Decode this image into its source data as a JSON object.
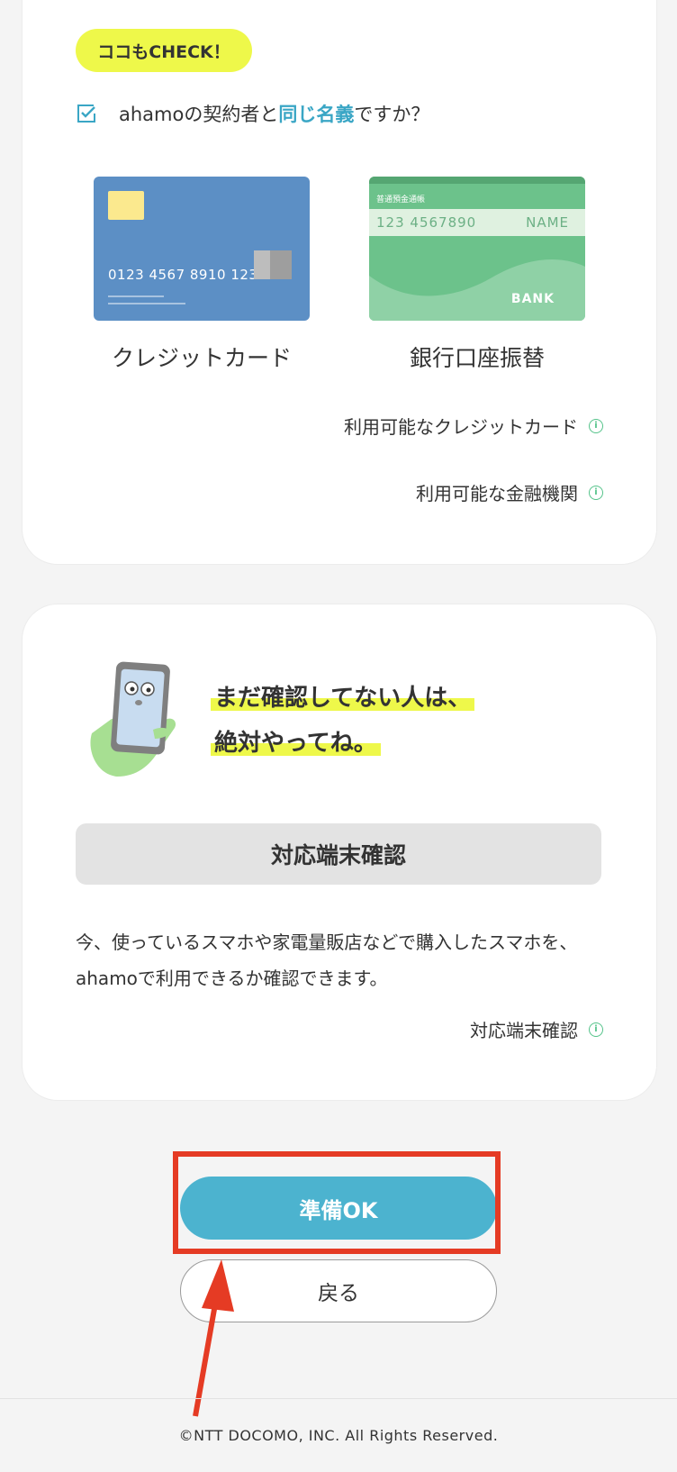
{
  "check_section": {
    "badge": "ココもCHECK！",
    "question_pre": "ahamoの契約者と",
    "question_highlight": "同じ名義",
    "question_post": "ですか？"
  },
  "credit_card": {
    "number": "0123 4567 8910 1234",
    "caption": "クレジットカード"
  },
  "bank_book": {
    "header": "普通預金通帳",
    "account": "123 4567890",
    "name": "NAME",
    "bank": "BANK",
    "caption": "銀行口座振替"
  },
  "links": {
    "credit_cards": "利用可能なクレジットカード",
    "banks": "利用可能な金融機関",
    "devices": "対応端末確認"
  },
  "device_section": {
    "headline1": "まだ確認してない人は、",
    "headline2": "絶対やってね。",
    "button": "対応端末確認",
    "description": "今、使っているスマホや家電量販店などで購入したスマホを、ahamoで利用できるか確認できます。"
  },
  "actions": {
    "ok": "準備OK",
    "back": "戻る"
  },
  "footer": "©NTT DOCOMO, INC. All Rights Reserved.",
  "colors": {
    "accent": "#4cb3cf",
    "highlight": "#eef84a",
    "annotation": "#e53b24"
  }
}
